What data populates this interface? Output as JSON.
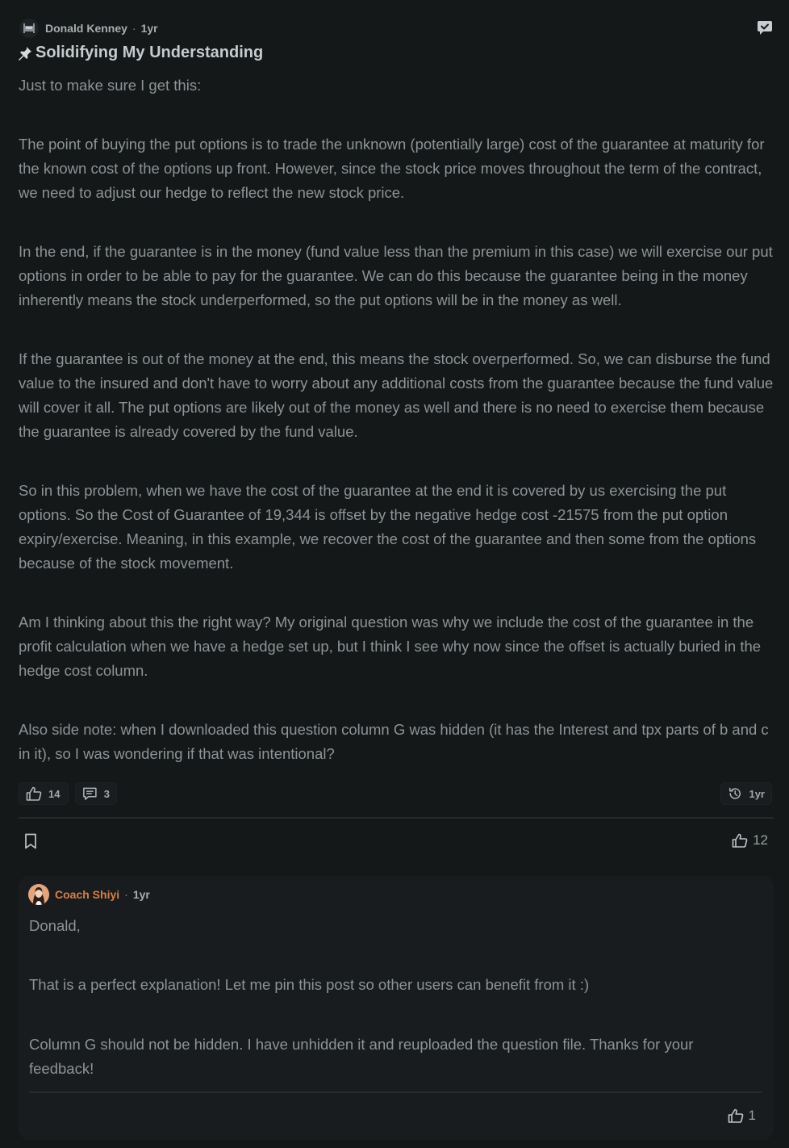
{
  "post": {
    "author": "Donald Kenney",
    "time": "1yr",
    "title": "Solidifying My Understanding",
    "paragraphs": [
      "Just to make sure I get this:",
      "The point of buying the put options is to trade the unknown (potentially large) cost of the guarantee at maturity for the known cost of the options up front. However, since the stock price moves throughout the term of the contract, we need to adjust our hedge to reflect the new stock price.",
      "In the end, if the guarantee is in the money (fund value less than the premium in this case) we will exercise our put options in order to be able to pay for the guarantee. We can do this because the guarantee being in the money inherently means the stock underperformed, so the put options will be in the money as well.",
      "If the guarantee is out of the money at the end, this means the stock overperformed. So, we can disburse the fund value to the insured and don't have to worry about any additional costs from the guarantee because the fund value will cover it all. The put options are likely out of the money as well and there is no need to exercise them because the guarantee is already covered by the fund value.",
      "So in this problem, when we have the cost of the guarantee at the end it is covered by us exercising the put options. So the Cost of Guarantee of 19,344 is offset by the negative hedge cost -21575 from the put option expiry/exercise. Meaning, in this example, we recover the cost of the guarantee and then some from the options because of the stock movement.",
      "Am I thinking about this the right way? My original question was why we include the cost of the guarantee in the profit calculation when we have a hedge set up, but I think I see why now since the offset is actually buried in the hedge cost column.",
      "Also side note: when I downloaded this question column G was hidden (it has the Interest and tpx parts of b and c in it), so I was wondering if that was intentional?"
    ],
    "stats": {
      "likes": "14",
      "comments": "3",
      "history": "1yr"
    },
    "footer_likes": "12"
  },
  "reply": {
    "author": "Coach Shiyi",
    "time": "1yr",
    "paragraphs": [
      "Donald,",
      "That is a perfect explanation! Let me pin this post so other users can benefit from it :)",
      "Column G should not be hidden. I have unhidden it and reuploaded the question file. Thanks for your feedback!"
    ],
    "likes": "1"
  },
  "colors": {
    "background": "#151819",
    "coach_accent": "#d68047",
    "text": "#8d9396"
  }
}
